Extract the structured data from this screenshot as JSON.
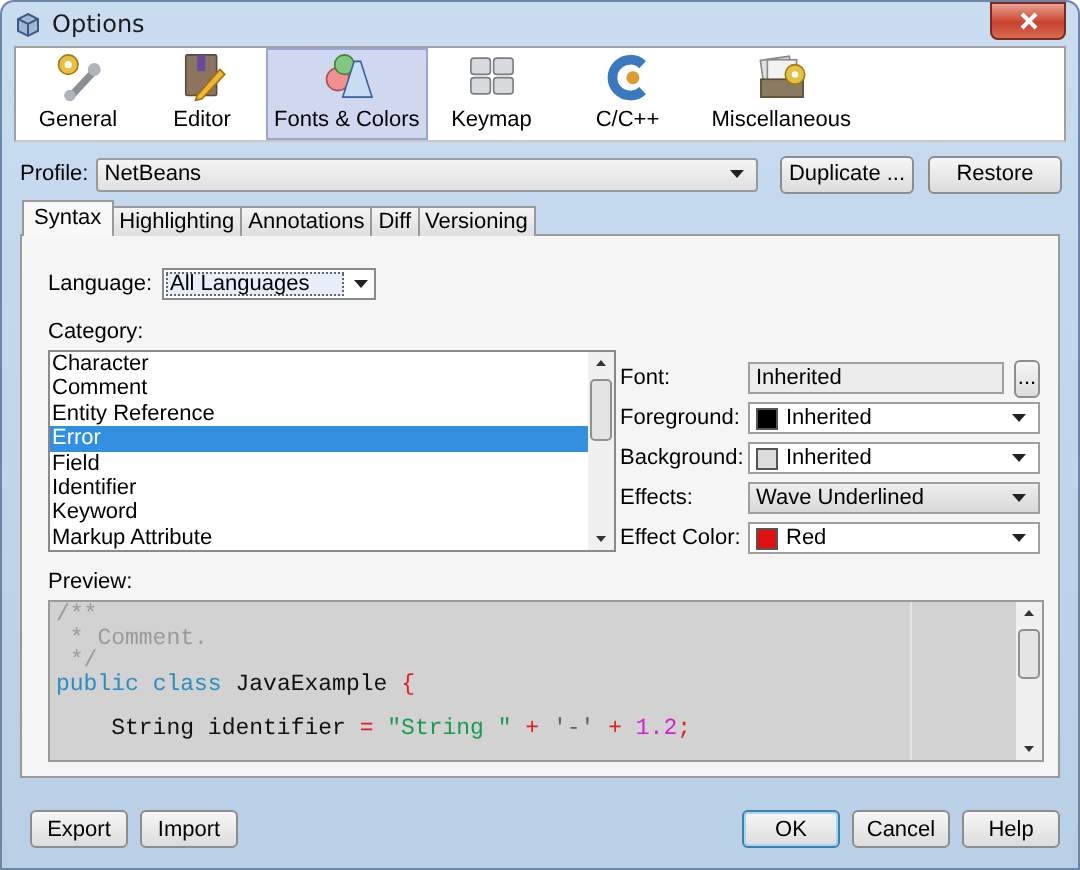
{
  "window": {
    "title": "Options"
  },
  "categories": [
    {
      "label": "General",
      "selected": false
    },
    {
      "label": "Editor",
      "selected": false
    },
    {
      "label": "Fonts & Colors",
      "selected": true
    },
    {
      "label": "Keymap",
      "selected": false
    },
    {
      "label": "C/C++",
      "selected": false
    },
    {
      "label": "Miscellaneous",
      "selected": false
    }
  ],
  "profile": {
    "label": "Profile:",
    "value": "NetBeans"
  },
  "profile_buttons": [
    "Duplicate ...",
    "Restore"
  ],
  "tabs": [
    {
      "label": "Syntax",
      "selected": true
    },
    {
      "label": "Highlighting",
      "selected": false
    },
    {
      "label": "Annotations",
      "selected": false
    },
    {
      "label": "Diff",
      "selected": false
    },
    {
      "label": "Versioning",
      "selected": false
    }
  ],
  "language": {
    "label": "Language:",
    "value": "All Languages"
  },
  "category_list": {
    "label": "Category:",
    "items": [
      {
        "label": "Character",
        "selected": false
      },
      {
        "label": "Comment",
        "selected": false
      },
      {
        "label": "Entity Reference",
        "selected": false
      },
      {
        "label": "Error",
        "selected": true
      },
      {
        "label": "Field",
        "selected": false
      },
      {
        "label": "Identifier",
        "selected": false
      },
      {
        "label": "Keyword",
        "selected": false
      },
      {
        "label": "Markup Attribute",
        "selected": false
      }
    ]
  },
  "properties": [
    {
      "kind": "field",
      "label": "Font:",
      "value": "Inherited",
      "button": "..."
    },
    {
      "kind": "color",
      "label": "Foreground:",
      "value": "Inherited",
      "color": "#000000"
    },
    {
      "kind": "color",
      "label": "Background:",
      "value": "Inherited",
      "color": "#dcdcdc"
    },
    {
      "kind": "choice",
      "label": "Effects:",
      "value": "Wave Underlined"
    },
    {
      "kind": "color",
      "label": "Effect Color:",
      "value": "Red",
      "color": "#e01010"
    }
  ],
  "preview": {
    "label": "Preview:",
    "lines": [
      {
        "blank_before": false,
        "tokens": [
          {
            "kind": "comment",
            "text": "/**"
          }
        ]
      },
      {
        "blank_before": false,
        "tokens": [
          {
            "kind": "comment",
            "text": " * Comment."
          }
        ]
      },
      {
        "blank_before": false,
        "tokens": [
          {
            "kind": "comment",
            "text": " */"
          }
        ]
      },
      {
        "blank_before": false,
        "tokens": [
          {
            "kind": "keyword",
            "text": "public"
          },
          {
            "kind": "keyword",
            "text": " class"
          },
          {
            "kind": "plain",
            "text": " JavaExample "
          },
          {
            "kind": "operator",
            "text": "{"
          }
        ]
      },
      {
        "blank_before": true,
        "tokens": [
          {
            "kind": "plain",
            "text": "    String identifier "
          },
          {
            "kind": "operator",
            "text": "="
          },
          {
            "kind": "string",
            "text": " \"String \""
          },
          {
            "kind": "operator",
            "text": " +"
          },
          {
            "kind": "char",
            "text": " '-'"
          },
          {
            "kind": "operator",
            "text": " +"
          },
          {
            "kind": "number",
            "text": " 1.2"
          },
          {
            "kind": "operator",
            "text": ";"
          }
        ]
      }
    ]
  },
  "footer_left": [
    {
      "label": "Export",
      "default": false
    },
    {
      "label": "Import",
      "default": false
    }
  ],
  "footer_right": [
    {
      "label": "OK",
      "default": true
    },
    {
      "label": "Cancel",
      "default": false
    },
    {
      "label": "Help",
      "default": false
    }
  ]
}
